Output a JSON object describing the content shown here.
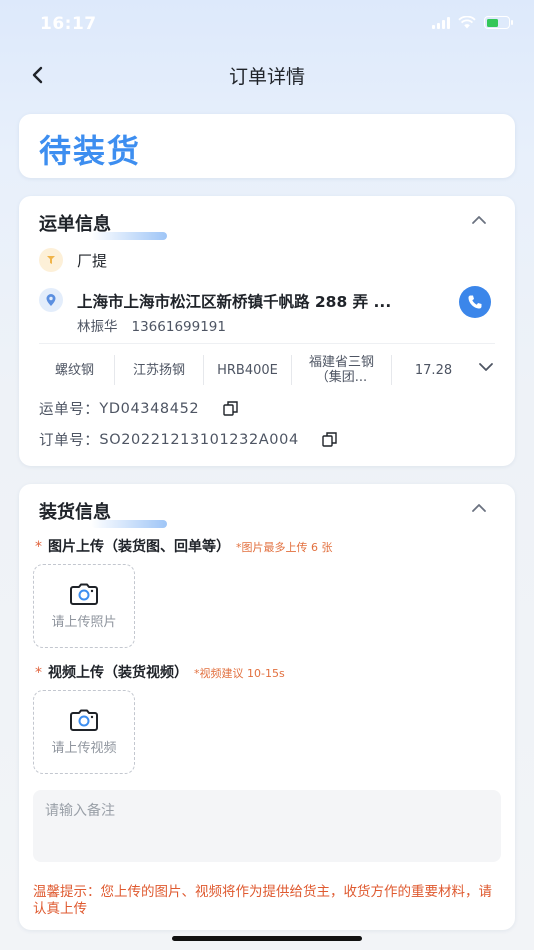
{
  "status_bar": {
    "time": "16:17"
  },
  "nav": {
    "title": "订单详情"
  },
  "order_status": "待装货",
  "waybill": {
    "heading": "运单信息",
    "origin": "厂提",
    "destination": "上海市上海市松江区新桥镇千帆路 288 弄 ...",
    "contact_name": "林振华",
    "contact_phone": "13661699191",
    "specs": [
      "螺纹钢",
      "江苏扬钢",
      "HRB400E",
      "福建省三钢（集团...",
      "17.28"
    ],
    "waybill_no_label": "运单号：",
    "waybill_no": "YD04348452",
    "order_no_label": "订单号：",
    "order_no": "SO20221213101232A004"
  },
  "loading": {
    "heading": "装货信息",
    "image_label": "图片上传（装货图、回单等）",
    "image_hint": "*图片最多上传 6 张",
    "image_button": "请上传照片",
    "video_label": "视频上传（装货视频）",
    "video_hint": "*视频建议 10-15s",
    "video_button": "请上传视频",
    "remark_placeholder": "请输入备注",
    "tip": "温馨提示：您上传的图片、视频将作为提供给货主，收货方作的重要材料，请认真上传"
  },
  "colors": {
    "accent": "#3d8ef0",
    "warning": "#df5a30",
    "phone": "#3b86ea"
  }
}
